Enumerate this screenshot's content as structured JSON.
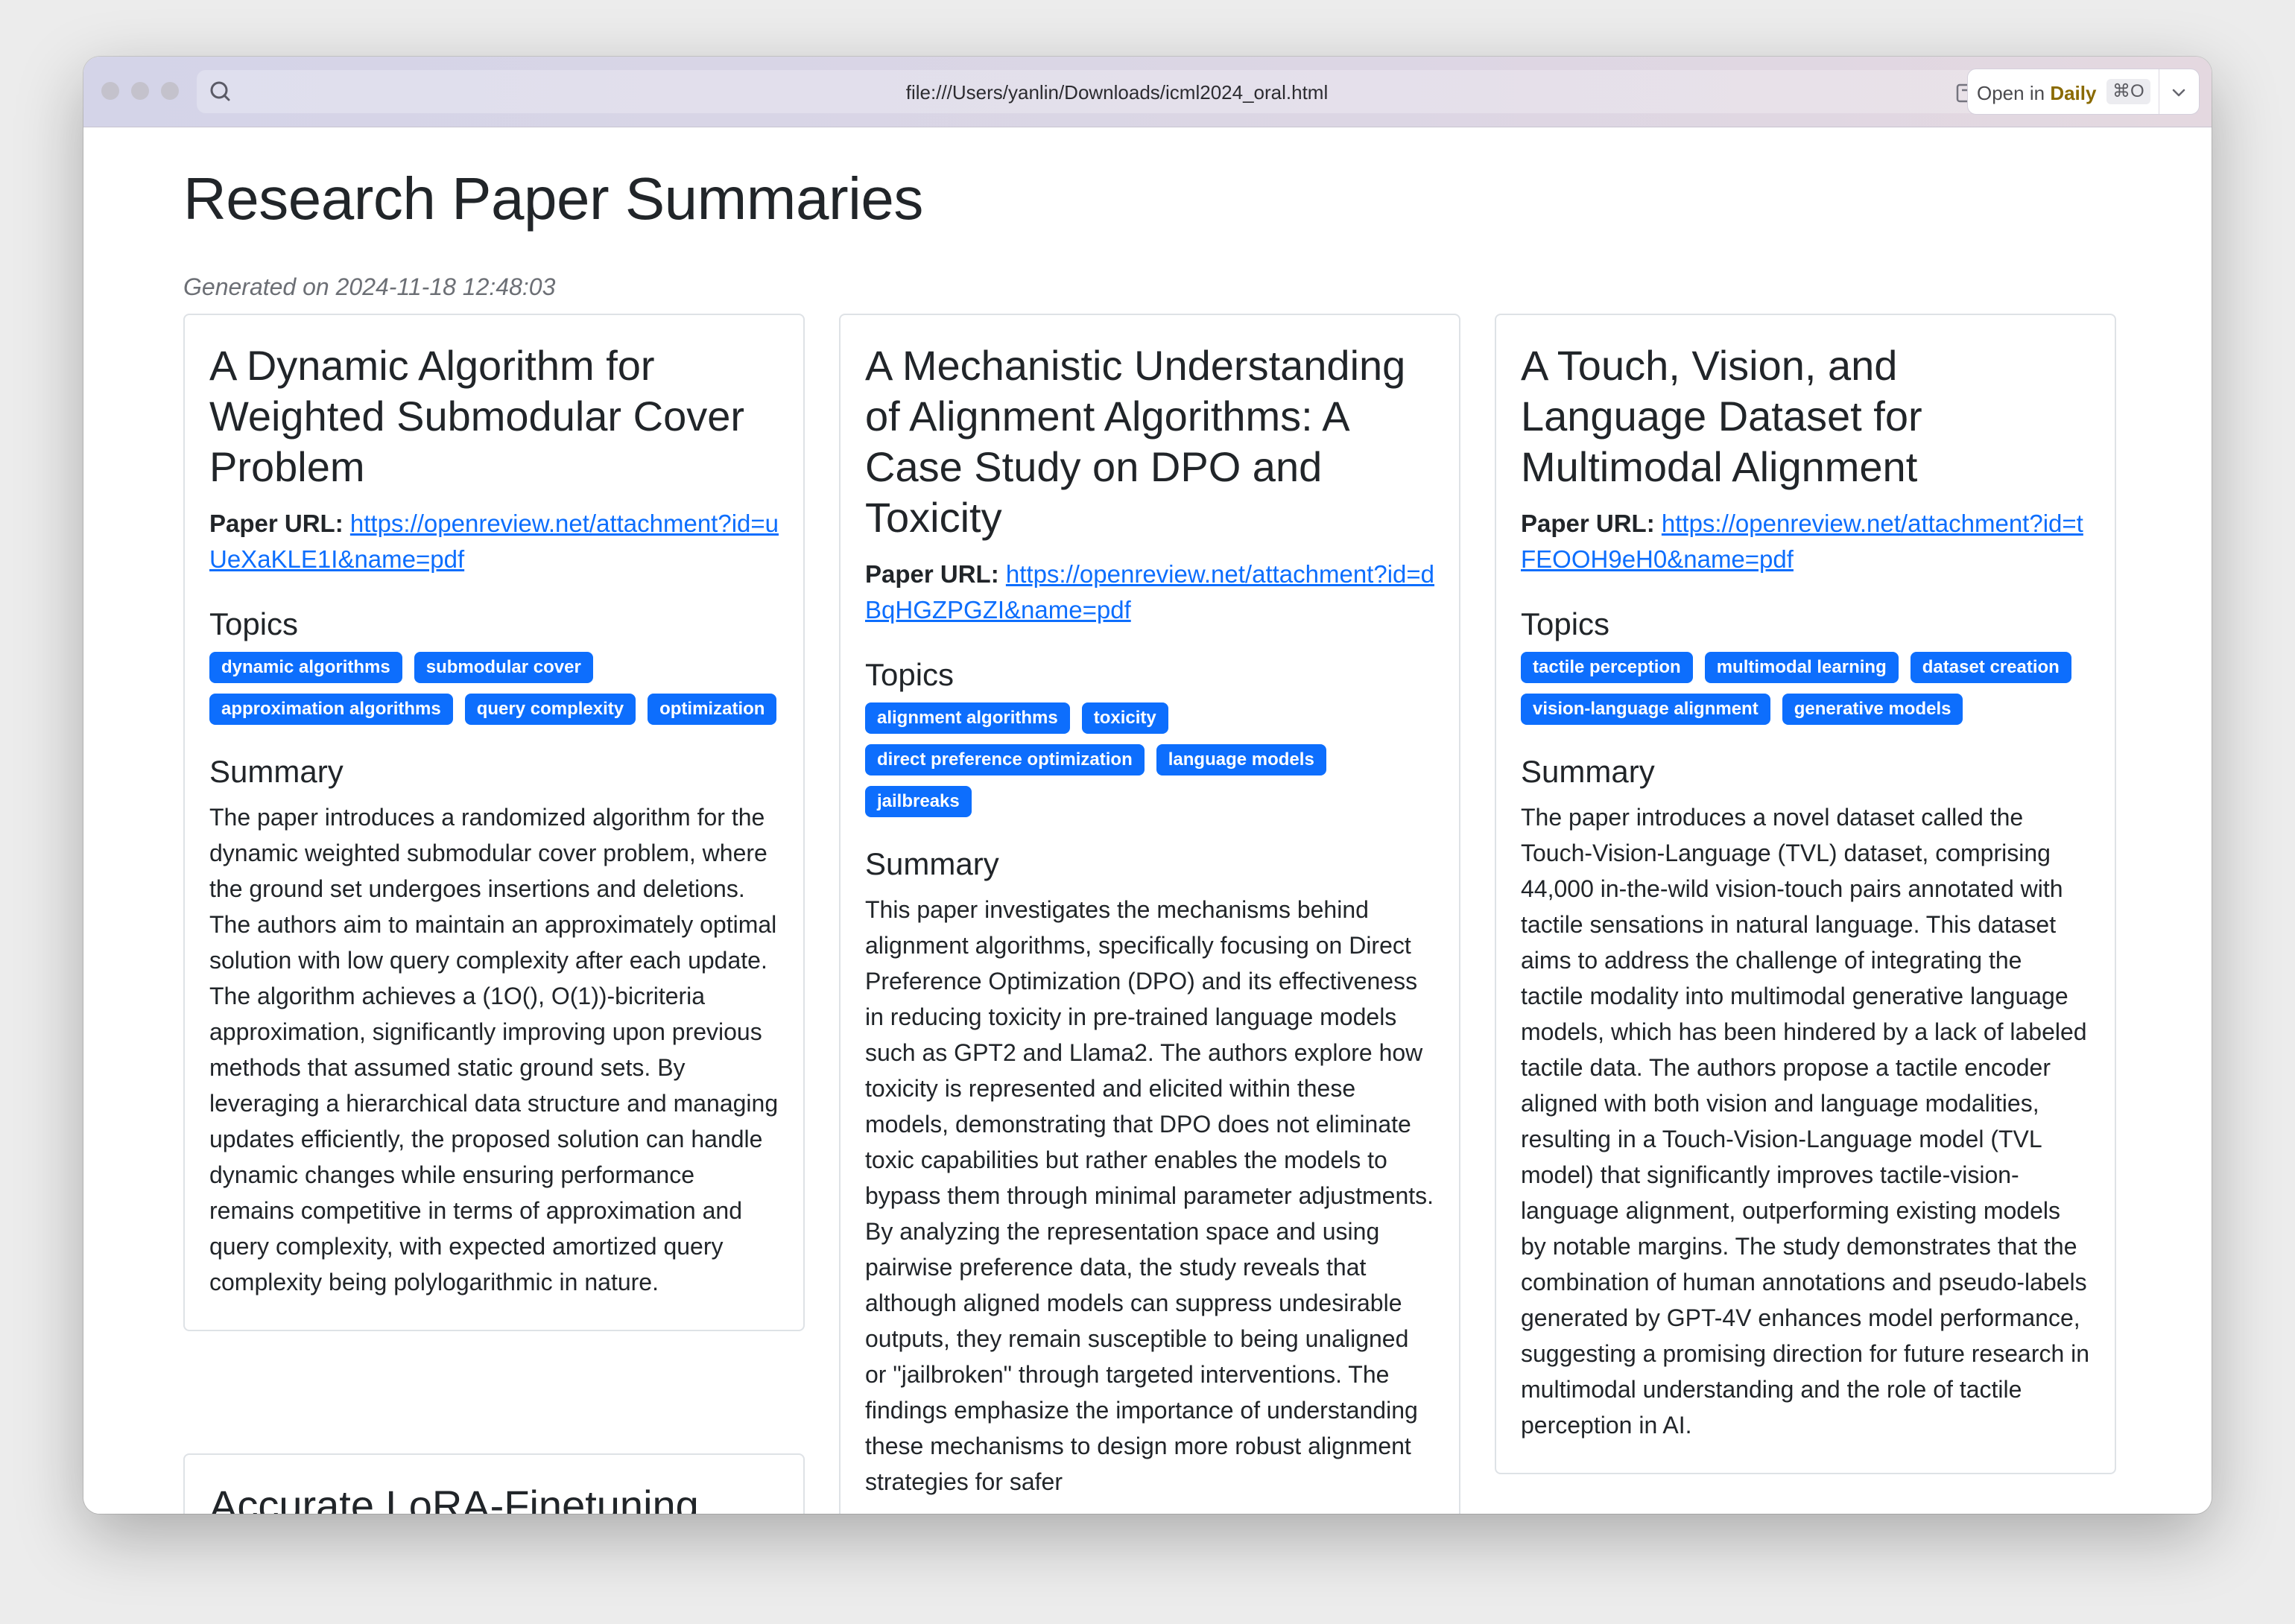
{
  "browser": {
    "url": "file:///Users/yanlin/Downloads/icml2024_oral.html",
    "open_in_prefix": "Open in",
    "open_in_app": "Daily",
    "open_in_shortcut": "⌘O",
    "accent_color": "#8a6a00"
  },
  "page": {
    "title": "Research Paper Summaries",
    "generated": "Generated on 2024-11-18 12:48:03",
    "url_label": "Paper URL:",
    "topics_heading": "Topics",
    "summary_heading": "Summary",
    "badge_color": "#0d6efd",
    "link_color": "#0d6efd"
  },
  "papers": [
    {
      "title": "A Dynamic Algorithm for Weighted Submodular Cover Problem",
      "url": "https://openreview.net/attachment?id=uUeXaKLE1I&name=pdf",
      "topics": [
        "dynamic algorithms",
        "submodular cover",
        "approximation algorithms",
        "query complexity",
        "optimization"
      ],
      "summary": "The paper introduces a randomized algorithm for the dynamic weighted submodular cover problem, where the ground set undergoes insertions and deletions. The authors aim to maintain an approximately optimal solution with low query complexity after each update. The algorithm achieves a (1O(), O(1))-bicriteria approximation, significantly improving upon previous methods that assumed static ground sets. By leveraging a hierarchical data structure and managing updates efficiently, the proposed solution can handle dynamic changes while ensuring performance remains competitive in terms of approximation and query complexity, with expected amortized query complexity being polylogarithmic in nature."
    },
    {
      "title": "A Mechanistic Understanding of Alignment Algorithms: A Case Study on DPO and Toxicity",
      "url": "https://openreview.net/attachment?id=dBqHGZPGZI&name=pdf",
      "topics": [
        "alignment algorithms",
        "toxicity",
        "direct preference optimization",
        "language models",
        "jailbreaks"
      ],
      "summary": "This paper investigates the mechanisms behind alignment algorithms, specifically focusing on Direct Preference Optimization (DPO) and its effectiveness in reducing toxicity in pre-trained language models such as GPT2 and Llama2. The authors explore how toxicity is represented and elicited within these models, demonstrating that DPO does not eliminate toxic capabilities but rather enables the models to bypass them through minimal parameter adjustments. By analyzing the representation space and using pairwise preference data, the study reveals that although aligned models can suppress undesirable outputs, they remain susceptible to being unaligned or \"jailbroken\" through targeted interventions. The findings emphasize the importance of understanding these mechanisms to design more robust alignment strategies for safer"
    },
    {
      "title": "A Touch, Vision, and Language Dataset for Multimodal Alignment",
      "url": "https://openreview.net/attachment?id=tFEOOH9eH0&name=pdf",
      "topics": [
        "tactile perception",
        "multimodal learning",
        "dataset creation",
        "vision-language alignment",
        "generative models"
      ],
      "summary": "The paper introduces a novel dataset called the Touch-Vision-Language (TVL) dataset, comprising 44,000 in-the-wild vision-touch pairs annotated with tactile sensations in natural language. This dataset aims to address the challenge of integrating the tactile modality into multimodal generative language models, which has been hindered by a lack of labeled tactile data. The authors propose a tactile encoder aligned with both vision and language modalities, resulting in a Touch-Vision-Language model (TVL model) that significantly improves tactile-vision-language alignment, outperforming existing models by notable margins. The study demonstrates that the combination of human annotations and pseudo-labels generated by GPT-4V enhances model performance, suggesting a promising direction for future research in multimodal understanding and the role of tactile perception in AI."
    },
    {
      "title": "Accurate LoRA-Finetuning"
    }
  ]
}
